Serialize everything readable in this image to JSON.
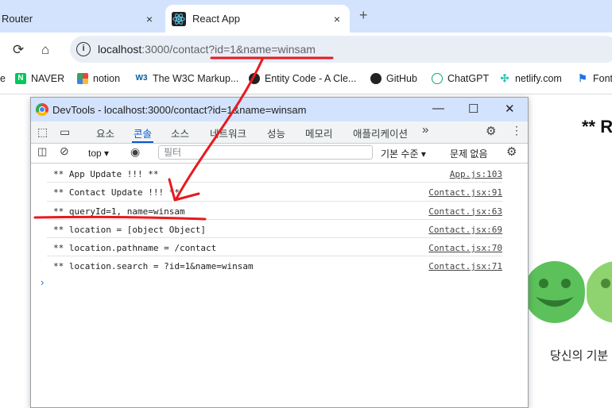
{
  "browser": {
    "tabs": [
      {
        "label": "Router",
        "close": "×"
      },
      {
        "label": "React App",
        "close": "×"
      }
    ],
    "new_tab": "+",
    "url_host": "localhost",
    "url_rest": ":3000/contact?id=1&name=winsam",
    "bookmarks": [
      {
        "label": "e",
        "icon": "bookmark-icon"
      },
      {
        "label": "NAVER",
        "icon": "naver-icon",
        "color": "#03c75a"
      },
      {
        "label": "notion",
        "icon": "notion-icon",
        "color": "#e8453c"
      },
      {
        "label": "The W3C Markup...",
        "icon": "w3c-icon"
      },
      {
        "label": "Entity Code - A Cle...",
        "icon": "entity-code-icon"
      },
      {
        "label": "GitHub",
        "icon": "github-icon"
      },
      {
        "label": "ChatGPT",
        "icon": "chatgpt-icon"
      },
      {
        "label": "netlify.com",
        "icon": "netlify-icon"
      },
      {
        "label": "Font",
        "icon": "flag-icon"
      }
    ]
  },
  "page": {
    "heading": "** R",
    "caption": "당신의 기분"
  },
  "devtools": {
    "title": "DevTools - localhost:3000/contact?id=1&name=winsam",
    "tabs": [
      "요소",
      "콘솔",
      "소스",
      "네트워크",
      "성능",
      "메모리",
      "애플리케이션",
      "»"
    ],
    "selected_tab": "콘솔",
    "context": "top",
    "filter_placeholder": "필터",
    "levels": "기본 수준",
    "issues": "문제 없음",
    "logs": [
      {
        "msg": "** App Update !!! **",
        "src": "App.js:103"
      },
      {
        "msg": "** Contact Update !!! **",
        "src": "Contact.jsx:91"
      },
      {
        "msg": "** queryId=1, name=winsam",
        "src": "Contact.jsx:63"
      },
      {
        "msg": "** location = [object Object]",
        "src": "Contact.jsx:69"
      },
      {
        "msg": "** location.pathname = /contact",
        "src": "Contact.jsx:70"
      },
      {
        "msg": "** location.search = ?id=1&name=winsam",
        "src": "Contact.jsx:71"
      }
    ],
    "prompt": "›"
  },
  "colors": {
    "accent": "#0b57d0",
    "annotation": "#e8191e",
    "smiley": "#5cc15a"
  }
}
